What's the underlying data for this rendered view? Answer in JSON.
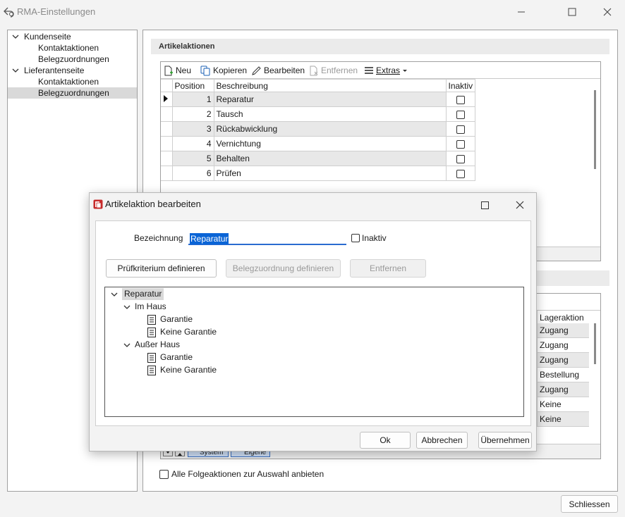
{
  "window": {
    "title": "RMA-Einstellungen"
  },
  "nav_tree": {
    "items": [
      {
        "label": "Kundenseite",
        "level": 0,
        "expanded": true
      },
      {
        "label": "Kontaktaktionen",
        "level": 1
      },
      {
        "label": "Belegzuordnungen",
        "level": 1
      },
      {
        "label": "Lieferantenseite",
        "level": 0,
        "expanded": true
      },
      {
        "label": "Kontaktaktionen",
        "level": 1
      },
      {
        "label": "Belegzuordnungen",
        "level": 1,
        "selected": true
      }
    ]
  },
  "artikelaktionen": {
    "heading": "Artikelaktionen",
    "toolbar": {
      "new": "Neu",
      "copy": "Kopieren",
      "edit": "Bearbeiten",
      "remove": "Entfernen",
      "extras": "Extras"
    },
    "columns": {
      "position": "Position",
      "description": "Beschreibung",
      "inactive": "Inaktiv"
    },
    "rows": [
      {
        "position": "1",
        "description": "Reparatur"
      },
      {
        "position": "2",
        "description": "Tausch"
      },
      {
        "position": "3",
        "description": "Rückabwicklung"
      },
      {
        "position": "4",
        "description": "Vernichtung"
      },
      {
        "position": "5",
        "description": "Behalten"
      },
      {
        "position": "6",
        "description": "Prüfen"
      }
    ]
  },
  "folgeaktionen": {
    "column_header": "Lageraktion",
    "values": [
      "Zugang",
      "Zugang",
      "Zugang",
      "Bestellung",
      "Zugang",
      "Keine",
      "Keine"
    ],
    "filter_system": "System",
    "filter_own": "Eigene"
  },
  "follow_option_label": "Alle Folgeaktionen zur Auswahl anbieten",
  "close_button": "Schliessen",
  "dialog": {
    "title": "Artikelaktion bearbeiten",
    "name_label": "Bezeichnung",
    "name_value": "Reparatur",
    "inactive_label": "Inaktiv",
    "btn_define_criteria": "Prüfkriterium definieren",
    "btn_define_doc": "Belegzuordnung definieren",
    "btn_remove": "Entfernen",
    "tree": {
      "root": "Reparatur",
      "groups": [
        {
          "label": "Im Haus",
          "children": [
            "Garantie",
            "Keine Garantie"
          ]
        },
        {
          "label": "Außer Haus",
          "children": [
            "Garantie",
            "Keine Garantie"
          ]
        }
      ]
    },
    "ok": "Ok",
    "cancel": "Abbrechen",
    "apply": "Übernehmen"
  },
  "colors": {
    "accent": "#0a64d6",
    "selection": "#d9d9d9",
    "row_shade": "#e8e8e8"
  }
}
